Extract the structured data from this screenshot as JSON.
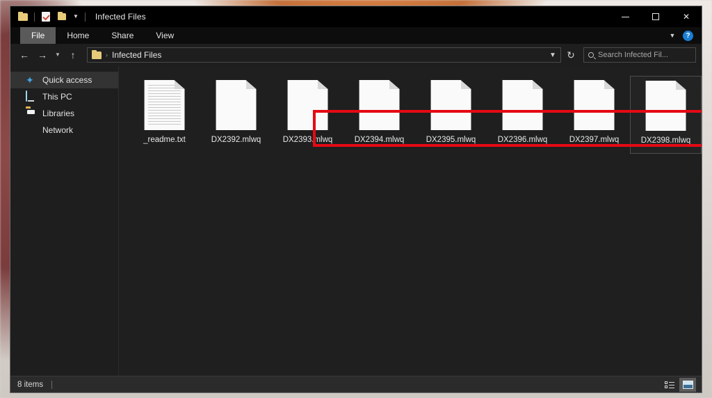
{
  "window": {
    "title": "Infected Files",
    "quick_access_toolbar": [
      {
        "name": "folder-properties-icon",
        "label": "Properties"
      },
      {
        "name": "new-folder-icon",
        "label": "New folder"
      },
      {
        "name": "customize-qat-chevron-icon",
        "label": "Customize Quick Access Toolbar"
      }
    ],
    "controls": {
      "minimize": "–",
      "maximize": "□",
      "close": "✕"
    }
  },
  "ribbon": {
    "tabs": [
      {
        "label": "File",
        "active": true
      },
      {
        "label": "Home",
        "active": false
      },
      {
        "label": "Share",
        "active": false
      },
      {
        "label": "View",
        "active": false
      }
    ],
    "collapse_chevron": "⌄",
    "help_label": "?"
  },
  "navigation": {
    "back": "←",
    "forward": "→",
    "recent": "⌄",
    "up": "↑",
    "breadcrumb": {
      "folder_icon": "folder-icon",
      "separator": "›",
      "path": "Infected Files"
    },
    "address_dropdown": "⌄",
    "refresh": "↻",
    "search": {
      "placeholder": "Search Infected Fil...",
      "value": ""
    }
  },
  "sidebar": {
    "items": [
      {
        "label": "Quick access",
        "icon": "star-icon",
        "selected": true
      },
      {
        "label": "This PC",
        "icon": "computer-icon",
        "selected": false
      },
      {
        "label": "Libraries",
        "icon": "libraries-folder-icon",
        "selected": false
      },
      {
        "label": "Network",
        "icon": "network-globe-icon",
        "selected": false
      }
    ]
  },
  "files": [
    {
      "name": "_readme.txt",
      "icon": "text-document-icon",
      "selected": false
    },
    {
      "name": "DX2392.mlwq",
      "icon": "blank-document-icon",
      "selected": false
    },
    {
      "name": "DX2393.mlwq",
      "icon": "blank-document-icon",
      "selected": false
    },
    {
      "name": "DX2394.mlwq",
      "icon": "blank-document-icon",
      "selected": false
    },
    {
      "name": "DX2395.mlwq",
      "icon": "blank-document-icon",
      "selected": false
    },
    {
      "name": "DX2396.mlwq",
      "icon": "blank-document-icon",
      "selected": false
    },
    {
      "name": "DX2397.mlwq",
      "icon": "blank-document-icon",
      "selected": false
    },
    {
      "name": "DX2398.mlwq",
      "icon": "blank-document-icon",
      "selected": true
    }
  ],
  "annotation": {
    "color": "#e50914",
    "shape": "rectangle",
    "description": "Red highlight box around the encrypted .mlwq files"
  },
  "statusbar": {
    "item_count": "8 items",
    "views": [
      {
        "name": "details-view-button",
        "active": false
      },
      {
        "name": "large-icons-view-button",
        "active": true
      }
    ]
  }
}
